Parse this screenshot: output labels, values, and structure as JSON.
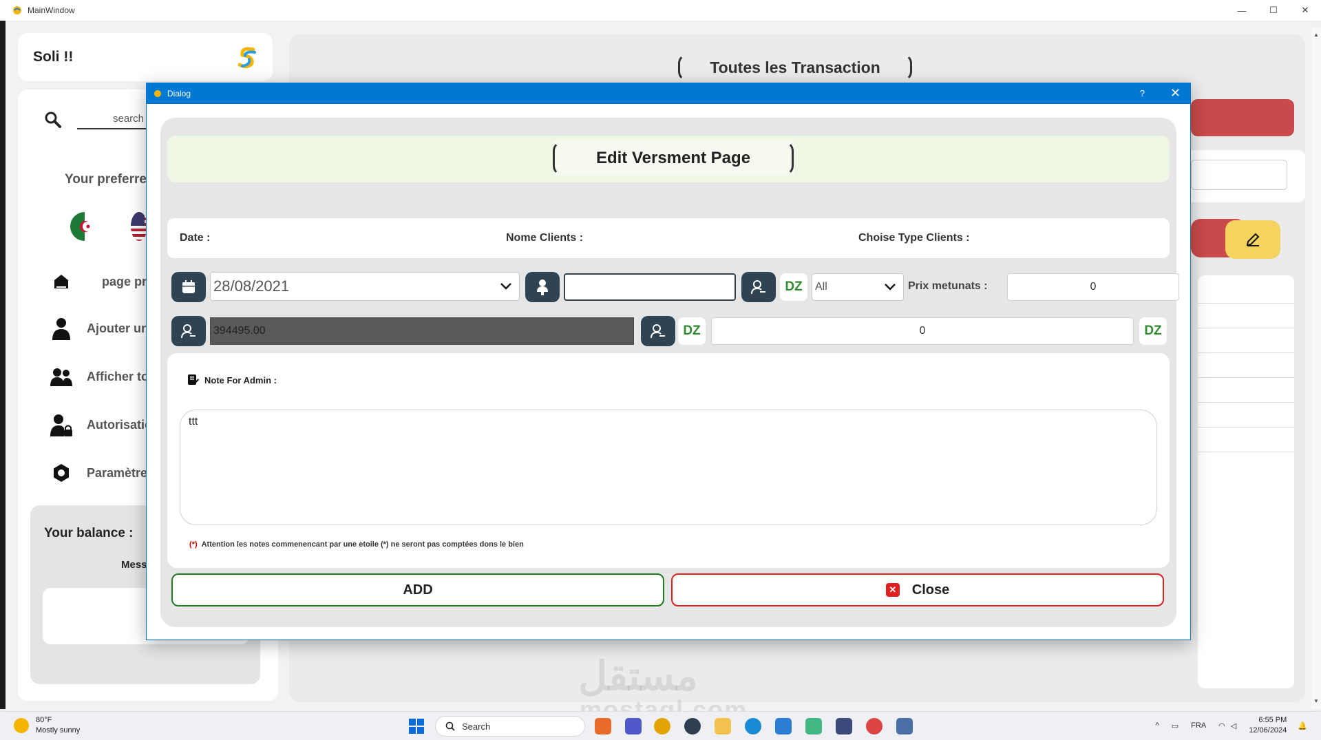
{
  "window": {
    "title": "MainWindow",
    "min": "—",
    "max": "☐",
    "close": "✕"
  },
  "sidebar": {
    "brand": "Soli !!",
    "search_placeholder": "search",
    "preferred_label": "Your preferre",
    "nav": [
      {
        "label": "page pri"
      },
      {
        "label": "Ajouter un"
      },
      {
        "label": "Afficher tou"
      },
      {
        "label": "Autorisatio"
      },
      {
        "label": "Paramètres"
      }
    ],
    "balance_label": "Your balance :",
    "balance_sub": "Mess"
  },
  "main": {
    "title": "Toutes les  Transaction"
  },
  "dialog": {
    "title": "Dialog",
    "help": "?",
    "close": "✕",
    "header": "Edit Versment Page",
    "labels": {
      "date": "Date :",
      "clients": "Nome Clients :",
      "type": "Choise Type Clients :"
    },
    "date_value": "28/08/2021",
    "client_value": "",
    "currency": "DZ",
    "type_value": "All",
    "prix_label": "Prix metunats :",
    "prix_value": "0",
    "balance_value": "394495.00",
    "amount_value": "0",
    "note_label": "Note For Admin :",
    "note_value": "ttt",
    "warning_star": "(*)",
    "warning": "Attention les notes commenencant par une etoile (*) ne seront pas comptées dons le bien",
    "add_button": "ADD",
    "close_button": "Close"
  },
  "taskbar": {
    "temp": "80°F",
    "weather": "Mostly sunny",
    "search": "Search",
    "lang": "FRA",
    "time": "6:55 PM",
    "date": "12/06/2024"
  },
  "colors": {
    "accent": "#0078d4",
    "dark_button": "#2f4353",
    "green": "#1e7a1e",
    "red": "#d22222"
  }
}
